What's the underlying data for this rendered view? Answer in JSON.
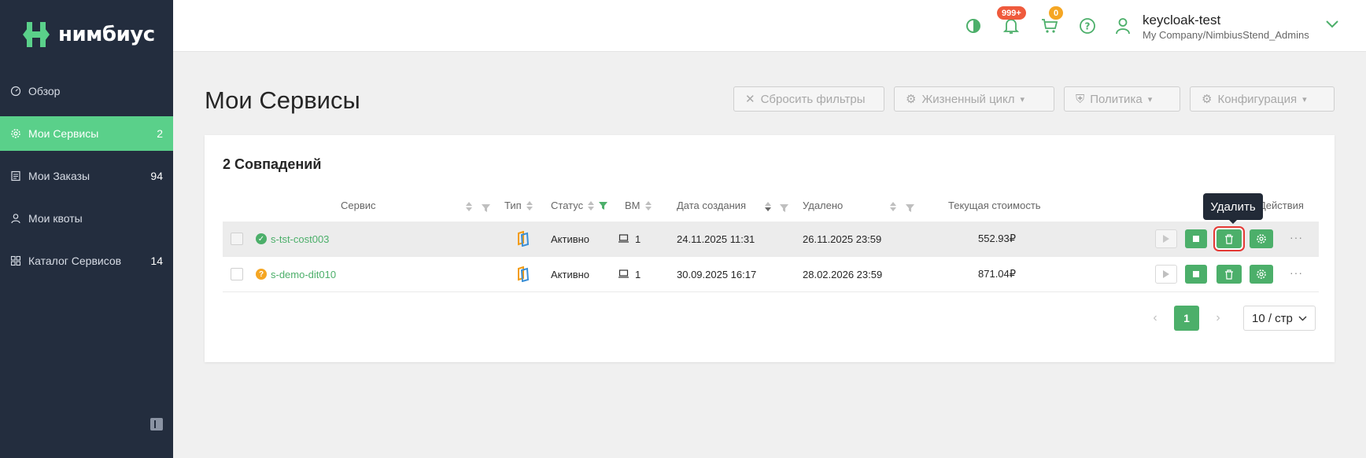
{
  "app": {
    "logo_text": "нимбиус"
  },
  "sidebar": {
    "items": [
      {
        "label": "Обзор",
        "count": "",
        "icon": "dashboard-icon"
      },
      {
        "label": "Мои Сервисы",
        "count": "2",
        "icon": "gear-icon"
      },
      {
        "label": "Мои Заказы",
        "count": "94",
        "icon": "document-icon"
      },
      {
        "label": "Мои квоты",
        "count": "",
        "icon": "user-icon"
      },
      {
        "label": "Каталог Сервисов",
        "count": "14",
        "icon": "grid-icon"
      }
    ]
  },
  "header": {
    "notifications_badge": "999+",
    "cart_badge": "0",
    "user_name": "keycloak-test",
    "user_org": "My Company/NimbiusStend_Admins"
  },
  "page": {
    "title": "Мои Сервисы",
    "reset_filters": "Сбросить фильтры",
    "lifecycle": "Жизненный цикл",
    "policy": "Политика",
    "configuration": "Конфигурация"
  },
  "table": {
    "matches": "2 Совпадений",
    "columns": {
      "service": "Сервис",
      "type": "Тип",
      "status": "Статус",
      "vm": "ВМ",
      "created": "Дата создания",
      "deleted": "Удалено",
      "cost": "Текущая стоимость",
      "actions": "Действия"
    },
    "rows": [
      {
        "name": "s-tst-cost003",
        "status": "Активно",
        "vm": "1",
        "created": "24.11.2025 11:31",
        "deleted": "26.11.2025 23:59",
        "cost": "552.93₽"
      },
      {
        "name": "s-demo-dit010",
        "status": "Активно",
        "vm": "1",
        "created": "30.09.2025 16:17",
        "deleted": "28.02.2026 23:59",
        "cost": "871.04₽"
      }
    ],
    "tooltip": "Удалить"
  },
  "pagination": {
    "current_page": "1",
    "page_size": "10 / стр"
  },
  "colors": {
    "accent": "#5ad08a",
    "sidebar_bg": "#232d3e",
    "danger_outline": "#e53935"
  }
}
